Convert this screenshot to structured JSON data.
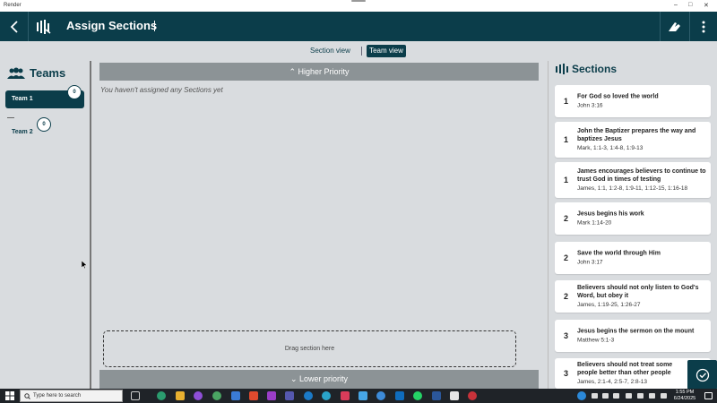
{
  "window": {
    "title": "Render"
  },
  "header": {
    "title": "Assign Sections"
  },
  "view_toggle": {
    "section_view": "Section view",
    "team_view": "Team view"
  },
  "teams": {
    "title": "Teams",
    "items": [
      {
        "label": "Team 1",
        "count": "0"
      },
      {
        "label": "Team 2",
        "count": "0"
      }
    ]
  },
  "main": {
    "higher_priority": "Higher Priority",
    "lower_priority": "Lower priority",
    "empty_message": "You haven't assigned any Sections yet",
    "drop_zone": "Drag section here"
  },
  "sections": {
    "title": "Sections",
    "items": [
      {
        "number": "1",
        "title": "For God so loved the world",
        "ref": "John 3:16"
      },
      {
        "number": "1",
        "title": "John the Baptizer prepares the way and baptizes Jesus",
        "ref": "Mark, 1:1-3, 1:4-8, 1:9-13"
      },
      {
        "number": "1",
        "title": "James encourages believers to continue to trust God in times of testing",
        "ref": "James, 1:1, 1:2-8, 1:9-11, 1:12-15, 1:16-18"
      },
      {
        "number": "2",
        "title": "Jesus begins his work",
        "ref": "Mark 1:14-20"
      },
      {
        "number": "2",
        "title": "Save the world through Him",
        "ref": "John 3:17"
      },
      {
        "number": "2",
        "title": "Believers should not only listen to God's Word, but obey it",
        "ref": "James, 1:19-25, 1:26-27"
      },
      {
        "number": "3",
        "title": "Jesus begins the sermon on the mount",
        "ref": "Matthew 5:1-3"
      },
      {
        "number": "3",
        "title": "Believers should not treat some people better than other people",
        "ref": "James, 2:1-4, 2:5-7, 2:8-13"
      }
    ]
  },
  "taskbar": {
    "search_placeholder": "Type here to search",
    "time": "1:55 PM",
    "date": "6/24/2025"
  },
  "colors": {
    "primary": "#0b3d4a",
    "priority_bar": "#8c9396",
    "background": "#d9dcdf"
  }
}
